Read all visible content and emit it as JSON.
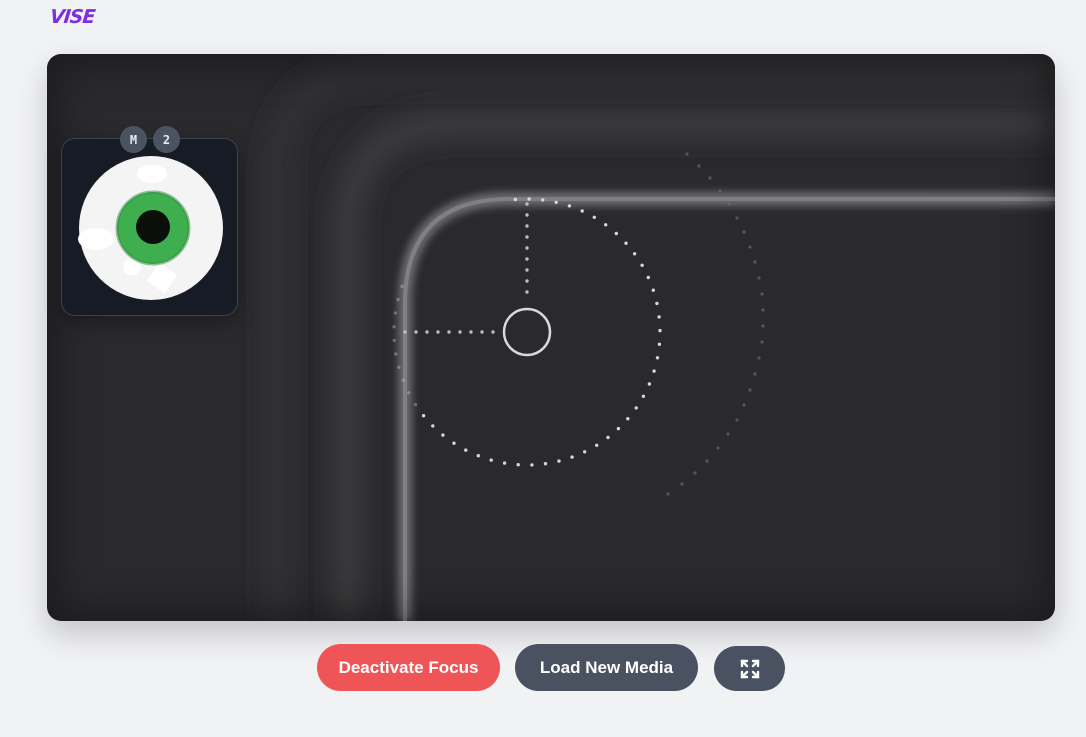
{
  "app": {
    "logo_text": "VISE"
  },
  "thumbnail": {
    "badges": [
      "M",
      "2"
    ],
    "icon": "eye-icon"
  },
  "controls": {
    "focus_label": "Deactivate Focus",
    "load_label": "Load New Media",
    "fullscreen_icon": "expand-icon"
  },
  "colors": {
    "brand": "#7c2fe0",
    "focus_button": "#ef5557",
    "secondary_button": "#4a5261",
    "viewer_bg": "#2a2a2d",
    "iris": "#3fae4f"
  }
}
